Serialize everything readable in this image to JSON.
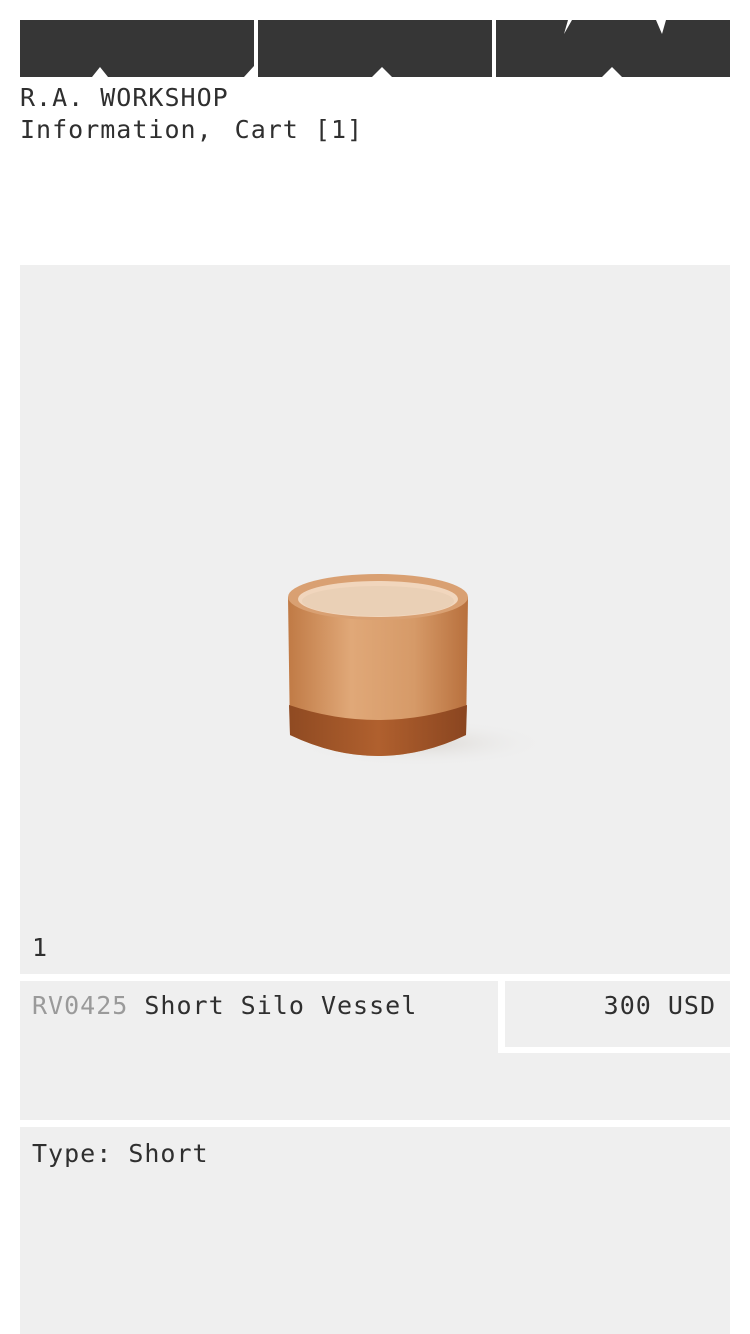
{
  "header": {
    "brand": "R.A. WORKSHOP",
    "nav": {
      "information": "Information",
      "separator": ",",
      "cart": "Cart [1]"
    }
  },
  "product": {
    "image_counter": "1",
    "sku": "RV0425",
    "name": "Short Silo Vessel",
    "price": "300 USD",
    "type_label": "Type:",
    "type_value": "Short"
  },
  "colors": {
    "logo": "#363636",
    "panel": "#efefef",
    "text": "#2f2f2f",
    "sku_text": "#9a9a9a",
    "vessel": "#c98a55"
  }
}
